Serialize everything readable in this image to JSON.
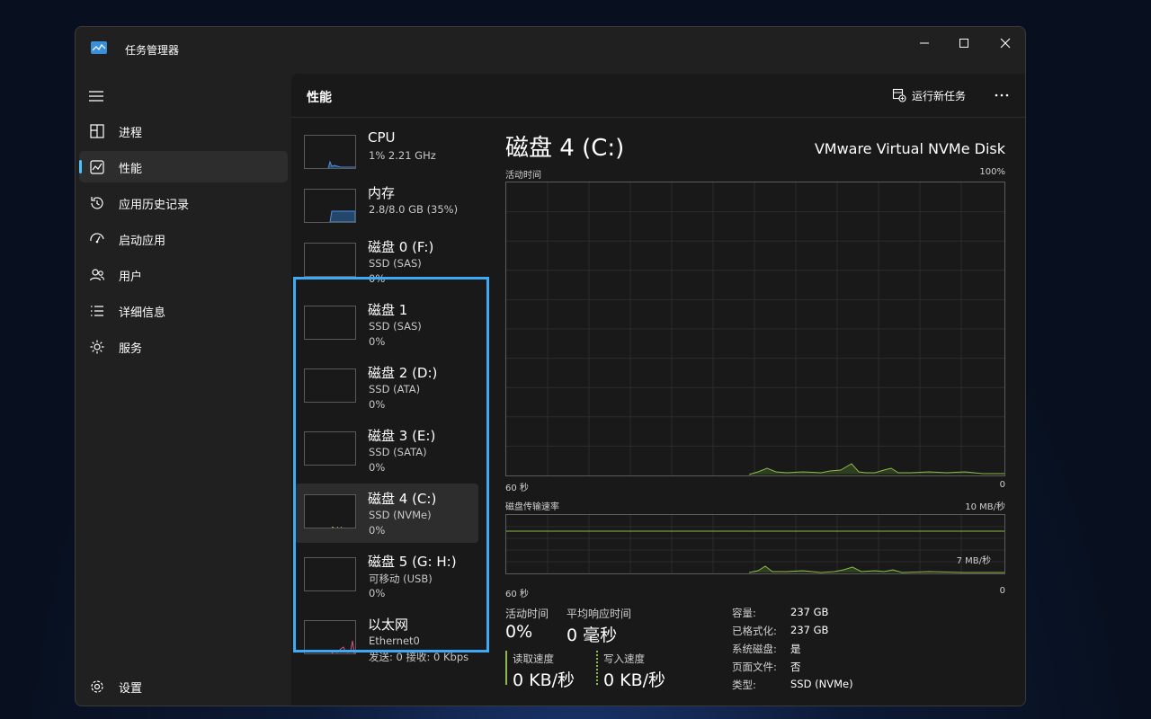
{
  "window": {
    "title": "任务管理器"
  },
  "colors": {
    "accent": "#4cc2ff",
    "highlight": "#3fa9f5",
    "disk_graph": "#8bb94a",
    "memory_graph": "#4a90e2",
    "network_graph": "#d0588a"
  },
  "sidebar": {
    "items": [
      {
        "label": "进程",
        "icon": "processes-icon"
      },
      {
        "label": "性能",
        "icon": "performance-icon"
      },
      {
        "label": "应用历史记录",
        "icon": "app-history-icon"
      },
      {
        "label": "启动应用",
        "icon": "startup-apps-icon"
      },
      {
        "label": "用户",
        "icon": "users-icon"
      },
      {
        "label": "详细信息",
        "icon": "details-icon"
      },
      {
        "label": "服务",
        "icon": "services-icon"
      }
    ],
    "settings_label": "设置"
  },
  "header": {
    "title": "性能",
    "run_new_task": "运行新任务"
  },
  "resources": [
    {
      "name": "CPU",
      "line2": "1% 2.21 GHz",
      "line3": ""
    },
    {
      "name": "内存",
      "line2": "2.8/8.0 GB (35%)",
      "line3": ""
    },
    {
      "name": "磁盘 0 (F:)",
      "line2": "SSD (SAS)",
      "line3": "0%"
    },
    {
      "name": "磁盘 1",
      "line2": "SSD (SAS)",
      "line3": "0%"
    },
    {
      "name": "磁盘 2 (D:)",
      "line2": "SSD (ATA)",
      "line3": "0%"
    },
    {
      "name": "磁盘 3 (E:)",
      "line2": "SSD (SATA)",
      "line3": "0%"
    },
    {
      "name": "磁盘 4 (C:)",
      "line2": "SSD (NVMe)",
      "line3": "0%"
    },
    {
      "name": "磁盘 5 (G: H:)",
      "line2": "可移动 (USB)",
      "line3": "0%"
    },
    {
      "name": "以太网",
      "line2": "Ethernet0",
      "line3": "发送: 0 接收: 0 Kbps"
    }
  ],
  "detail": {
    "title": "磁盘 4 (C:)",
    "model": "VMware Virtual NVMe Disk",
    "graph1": {
      "label": "活动时间",
      "max": "100%",
      "xleft": "60 秒",
      "xright": "0"
    },
    "graph2": {
      "label": "磁盘传输速率",
      "max": "10 MB/秒",
      "mid": "7 MB/秒",
      "xleft": "60 秒",
      "xright": "0"
    },
    "stats": {
      "active_time_label": "活动时间",
      "active_time_value": "0%",
      "avg_response_label": "平均响应时间",
      "avg_response_value": "0 毫秒",
      "read_label": "读取速度",
      "read_value": "0 KB/秒",
      "write_label": "写入速度",
      "write_value": "0 KB/秒"
    },
    "properties": [
      {
        "key": "容量:",
        "value": "237 GB"
      },
      {
        "key": "已格式化:",
        "value": "237 GB"
      },
      {
        "key": "系统磁盘:",
        "value": "是"
      },
      {
        "key": "页面文件:",
        "value": "否"
      },
      {
        "key": "类型:",
        "value": "SSD (NVMe)"
      }
    ]
  }
}
